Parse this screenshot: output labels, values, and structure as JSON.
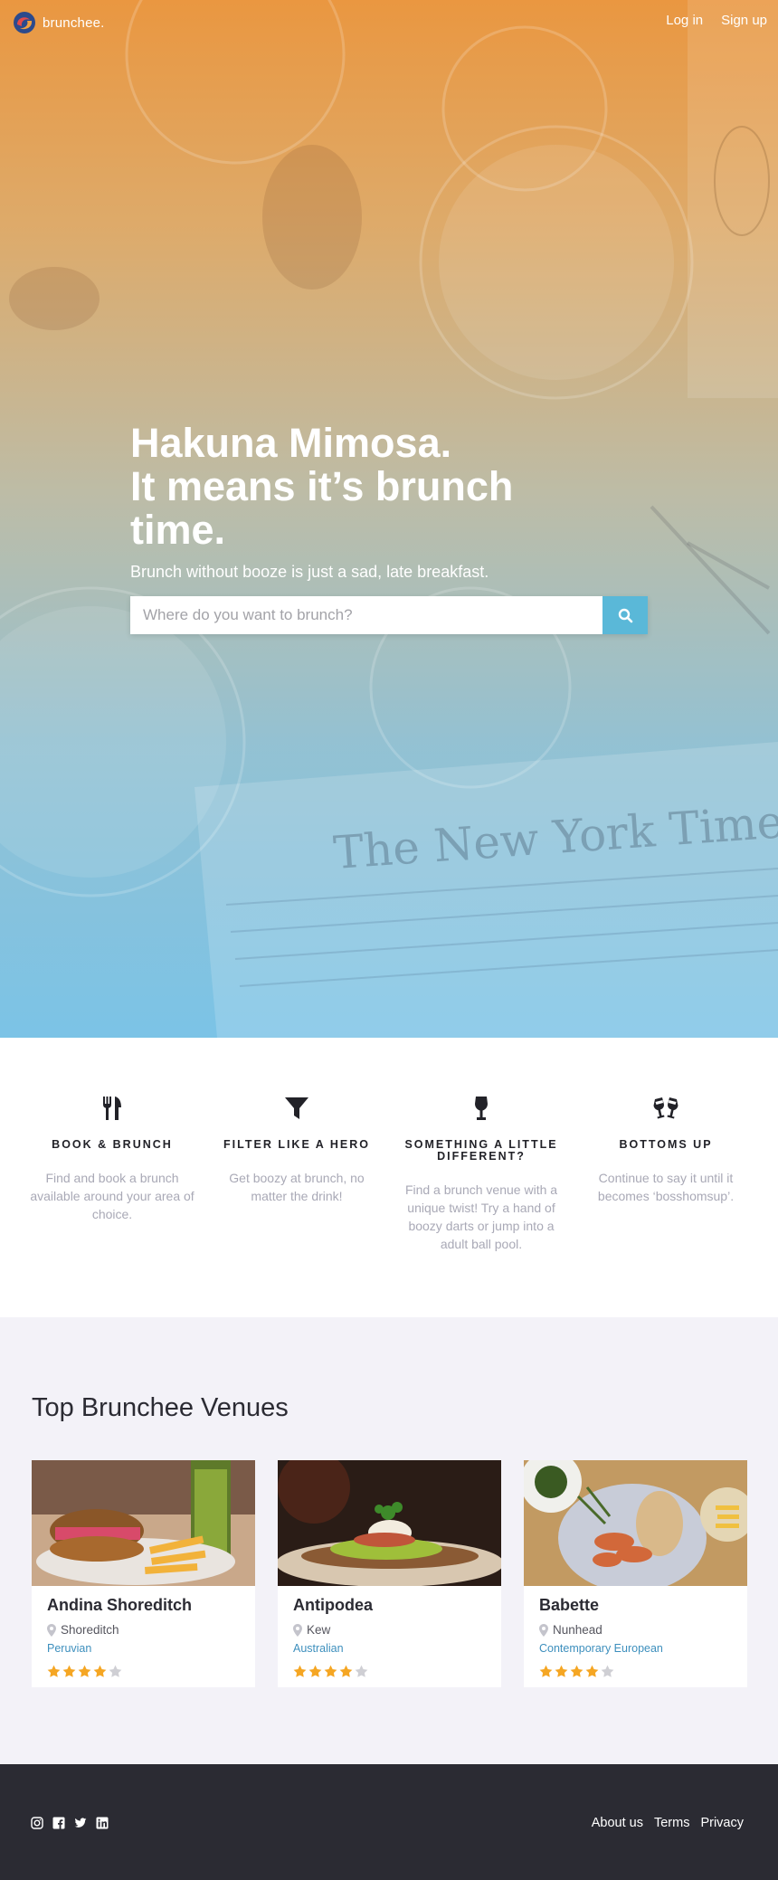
{
  "brand": {
    "name": "brunchee."
  },
  "nav": {
    "login": "Log in",
    "signup": "Sign up"
  },
  "hero": {
    "title_line1": "Hakuna Mimosa.",
    "title_line2": "It means it’s brunch",
    "title_line3": "time.",
    "subtitle": "Brunch without booze is just a sad, late breakfast.",
    "search_placeholder": "Where do you want to brunch?"
  },
  "features": [
    {
      "icon": "fork-knife-icon",
      "title": "Book & Brunch",
      "description": "Find and book a brunch available around your area of choice."
    },
    {
      "icon": "filter-icon",
      "title": "Filter like a hero",
      "description": "Get boozy at brunch, no matter the drink!"
    },
    {
      "icon": "wine-glass-icon",
      "title": "Something a little different?",
      "description": "Find a brunch venue with a unique twist! Try a hand of boozy darts or jump into a adult ball pool."
    },
    {
      "icon": "cheers-icon",
      "title": "Bottoms up",
      "description": "Continue to say it until it becomes ‘bosshomsup’."
    }
  ],
  "venues": {
    "title": "Top Brunchee Venues",
    "items": [
      {
        "name": "Andina Shoreditch",
        "location": "Shoreditch",
        "cuisine": "Peruvian",
        "rating": 4,
        "max_rating": 5
      },
      {
        "name": "Antipodea",
        "location": "Kew",
        "cuisine": "Australian",
        "rating": 4,
        "max_rating": 5
      },
      {
        "name": "Babette",
        "location": "Nunhead",
        "cuisine": "Contemporary European",
        "rating": 4,
        "max_rating": 5
      }
    ]
  },
  "footer": {
    "social": [
      "instagram-icon",
      "facebook-icon",
      "twitter-icon",
      "linkedin-icon"
    ],
    "links": {
      "about": "About us",
      "terms": "Terms",
      "privacy": "Privacy"
    }
  },
  "colors": {
    "accent": "#5ab8d8",
    "hero_top": "#e88f32",
    "hero_bottom": "#70bee4",
    "star": "#f5a623",
    "star_empty": "#cfcfd4",
    "link": "#3d8fbd",
    "footer_bg": "#2b2b33",
    "venues_bg": "#f3f2f8"
  }
}
